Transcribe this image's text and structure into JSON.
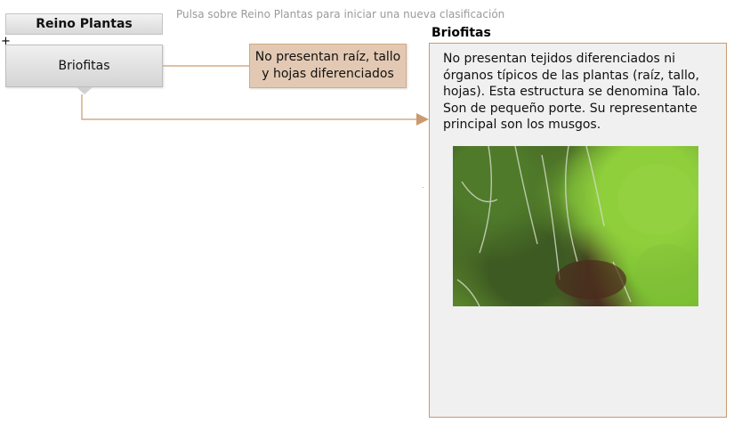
{
  "root": {
    "label": "Reino Plantas"
  },
  "hint": "Pulsa sobre Reino Plantas para iniciar una nueva clasificación",
  "node": {
    "label": "Briofitas"
  },
  "characteristic": "No presentan raíz, tallo y hojas diferenciados",
  "panel": {
    "title": "Briofitas",
    "text": "No presentan tejidos diferenciados ni órganos típicos de las plantas (raíz, tallo, hojas). Esta estructura se denomina Talo. Son de pequeño porte. Su representante principal son los musgos."
  },
  "colors": {
    "connector": "#c99a6e",
    "characteristic_bg": "#e3c9b3",
    "panel_bg": "#f0f0f0"
  },
  "icons": {
    "plus": "plus-icon",
    "arrow": "arrow-right-icon"
  }
}
